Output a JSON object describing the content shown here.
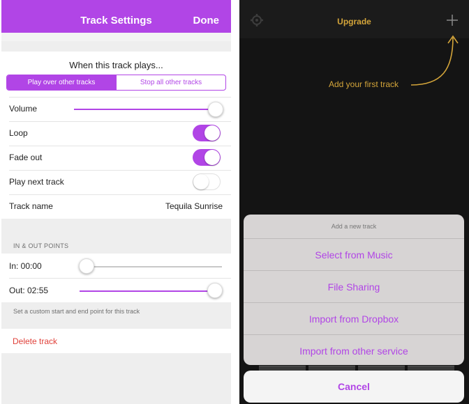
{
  "colors": {
    "accent": "#b145e6",
    "gold": "#d4a53a",
    "danger": "#e0413a"
  },
  "settings": {
    "nav": {
      "title": "Track Settings",
      "done": "Done"
    },
    "when_plays": "When this track plays...",
    "segment": {
      "option1": "Play over other tracks",
      "option2": "Stop all other tracks",
      "selected": "Play over other tracks"
    },
    "rows": {
      "volume": {
        "label": "Volume",
        "level": 1.0
      },
      "loop": {
        "label": "Loop",
        "on": true
      },
      "fade_out": {
        "label": "Fade out",
        "on": true
      },
      "play_next": {
        "label": "Play next track",
        "on": false
      },
      "track_name": {
        "label": "Track name",
        "value": "Tequila Sunrise"
      }
    },
    "points": {
      "header": "IN & OUT POINTS",
      "in": {
        "label": "In: 00:00",
        "level": 0.0
      },
      "out": {
        "label": "Out: 02:55",
        "level": 1.0
      },
      "hint": "Set a custom start and end point for this track"
    },
    "delete": "Delete track"
  },
  "library": {
    "header": {
      "upgrade": "Upgrade",
      "left_icon": "gear-icon",
      "right_icon": "plus-icon"
    },
    "hint": "Add your first track",
    "sheet": {
      "title": "Add a new track",
      "items": [
        "Select from Music",
        "File Sharing",
        "Import from Dropbox",
        "Import from other service"
      ],
      "cancel": "Cancel"
    }
  }
}
